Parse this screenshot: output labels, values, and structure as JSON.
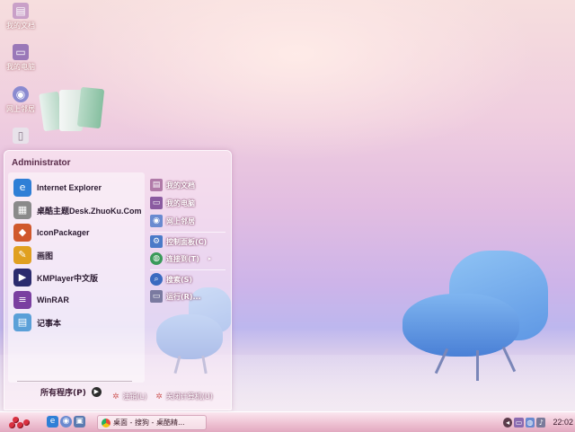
{
  "desktop": {
    "icons": [
      {
        "label": "我的文档",
        "icon": "folder-icon"
      },
      {
        "label": "我的电脑",
        "icon": "computer-icon"
      },
      {
        "label": "网上邻居",
        "icon": "network-icon"
      },
      {
        "label": "",
        "icon": "recycle-bin-icon"
      }
    ]
  },
  "start_menu": {
    "user": "Administrator",
    "programs": [
      {
        "label": "Internet Explorer",
        "icon": "internet-explorer-icon",
        "color": "#2f7fd6"
      },
      {
        "label": "桌酷主题Desk.ZhuoKu.Com",
        "icon": "zhuoku-theme-icon",
        "color": "#8a8a8a"
      },
      {
        "label": "IconPackager",
        "icon": "iconpackager-icon",
        "color": "#d0582c"
      },
      {
        "label": "画图",
        "icon": "paint-icon",
        "color": "#e0a020"
      },
      {
        "label": "KMPlayer中文版",
        "icon": "kmplayer-icon",
        "color": "#2b2b6e"
      },
      {
        "label": "WinRAR",
        "icon": "winrar-icon",
        "color": "#7a3fa0"
      },
      {
        "label": "记事本",
        "icon": "notepad-icon",
        "color": "#5aa0d8"
      }
    ],
    "all_programs": "所有程序(P)",
    "places": [
      {
        "label": "我的文档",
        "icon": "documents-icon",
        "color": "#b07aa8"
      },
      {
        "label": "我的电脑",
        "icon": "computer-icon",
        "color": "#8a5aa0"
      },
      {
        "label": "网上邻居",
        "icon": "network-icon",
        "color": "#6a8ad0"
      },
      {
        "label": "控制面板(C)",
        "icon": "control-panel-icon",
        "color": "#4a7ac8"
      },
      {
        "label": "连接到(T)",
        "icon": "connect-to-icon",
        "color": "#3a9a5a",
        "submenu": "▸"
      },
      {
        "label": "搜索(S)",
        "icon": "search-icon",
        "color": "#3a6ac0"
      },
      {
        "label": "运行(R)...",
        "icon": "run-icon",
        "color": "#7a7aa0"
      }
    ],
    "logoff": "注销(L)",
    "shutdown": "关闭计算机(U)"
  },
  "taskbar": {
    "task_label": "桌面 - 搜狗 - 桌酷精...",
    "clock": "22:02"
  }
}
